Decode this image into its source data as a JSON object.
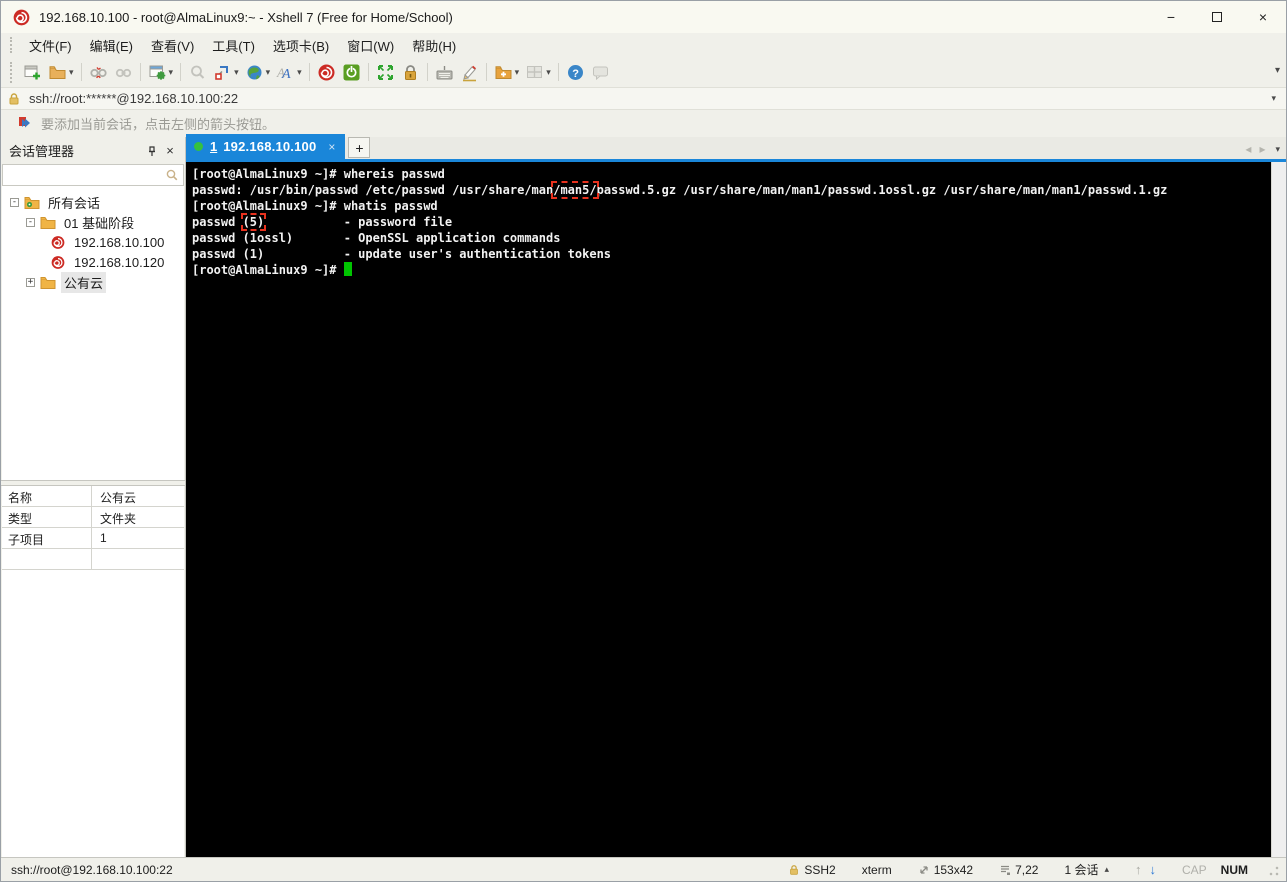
{
  "window": {
    "title": "192.168.10.100 - root@AlmaLinux9:~ - Xshell 7 (Free for Home/School)"
  },
  "menu": {
    "items": [
      "文件(F)",
      "编辑(E)",
      "查看(V)",
      "工具(T)",
      "选项卡(B)",
      "窗口(W)",
      "帮助(H)"
    ]
  },
  "toolbar": {
    "buttons": [
      "new-session",
      "open-session-folder",
      "disconnect",
      "reconnect",
      "session-properties",
      "find",
      "tile-layout",
      "encoding-globe",
      "font",
      "xshell",
      "xftp-transfer",
      "fullscreen",
      "lock-screen",
      "virtual-keyboard",
      "compose-pane",
      "new-folder",
      "split-pane",
      "help",
      "feedback"
    ]
  },
  "glyphs": {
    "caret_down": "▾",
    "caret_up": "▴",
    "minimize": "−",
    "close": "×",
    "plus": "+",
    "back": "◂",
    "forward": "▸",
    "up_arrow": "↑",
    "down_arrow": "↓",
    "collapse": "-",
    "expand": "+"
  },
  "addressbar": {
    "value": "ssh://root:******@192.168.10.100:22"
  },
  "infobar": {
    "message": "要添加当前会话，点击左侧的箭头按钮。"
  },
  "session_manager": {
    "title": "会话管理器",
    "search_value": "",
    "tree": {
      "all_sessions": "所有会话",
      "group": "01 基础阶段",
      "host1": "192.168.10.100",
      "host2": "192.168.10.120",
      "cloud": "公有云"
    }
  },
  "properties": {
    "rows": [
      {
        "key": "名称",
        "value": "公有云"
      },
      {
        "key": "类型",
        "value": "文件夹"
      },
      {
        "key": "子项目",
        "value": "1"
      }
    ]
  },
  "tabbar": {
    "active_index": "1",
    "active_label": "192.168.10.100"
  },
  "terminal": {
    "line1": "[root@AlmaLinux9 ~]# whereis passwd",
    "line2_pre": "passwd: /usr/bin/passwd /etc/passwd /usr/share/man",
    "line2_hl": "/man5/",
    "line2_post": "passwd.5.gz /usr/share/man/man1/passwd.1ossl.gz /usr/share/man/man1/passwd.1.gz",
    "line3": "[root@AlmaLinux9 ~]# whatis passwd",
    "line4_pre": "passwd ",
    "line4_hl": "(5)",
    "line4_post": "           - password file",
    "line5": "passwd (1ossl)       - OpenSSL application commands",
    "line6": "passwd (1)           - update user's authentication tokens",
    "prompt": "[root@AlmaLinux9 ~]# "
  },
  "statusbar": {
    "left": "ssh://root@192.168.10.100:22",
    "protocol": "SSH2",
    "term_type": "xterm",
    "size": "153x42",
    "cursor_pos": "7,22",
    "session_count": "1 会话",
    "cap": "CAP",
    "num": "NUM"
  },
  "colors": {
    "accent_blue": "#1a86d9",
    "terminal_bg": "#000000",
    "terminal_fg": "#f2f2f2",
    "cursor_green": "#00c400",
    "annotation_red": "#e8321e",
    "lock_gold": "#d9a43c",
    "tab_dot_green": "#35c13f"
  }
}
